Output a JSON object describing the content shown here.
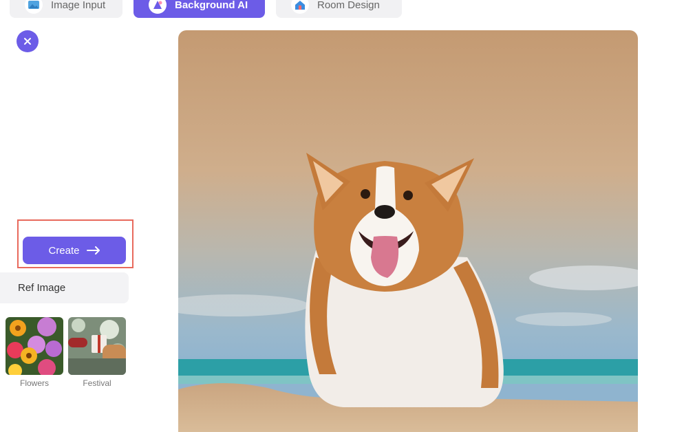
{
  "tabs": [
    {
      "label": "Image Input",
      "icon": "image-icon",
      "active": false
    },
    {
      "label": "Background AI",
      "icon": "background-ai-icon",
      "active": true
    },
    {
      "label": "Room Design",
      "icon": "house-icon",
      "active": false
    }
  ],
  "sidebar": {
    "close_icon": "close-icon",
    "create_label": "Create",
    "create_icon": "arrow-right-icon",
    "ref_image_label": "Ref Image",
    "thumbnails": [
      {
        "label": "Flowers"
      },
      {
        "label": "Festival"
      }
    ]
  },
  "preview": {
    "subject": "corgi on beach"
  },
  "colors": {
    "accent": "#6c5ce7",
    "highlight": "#e8695c"
  }
}
